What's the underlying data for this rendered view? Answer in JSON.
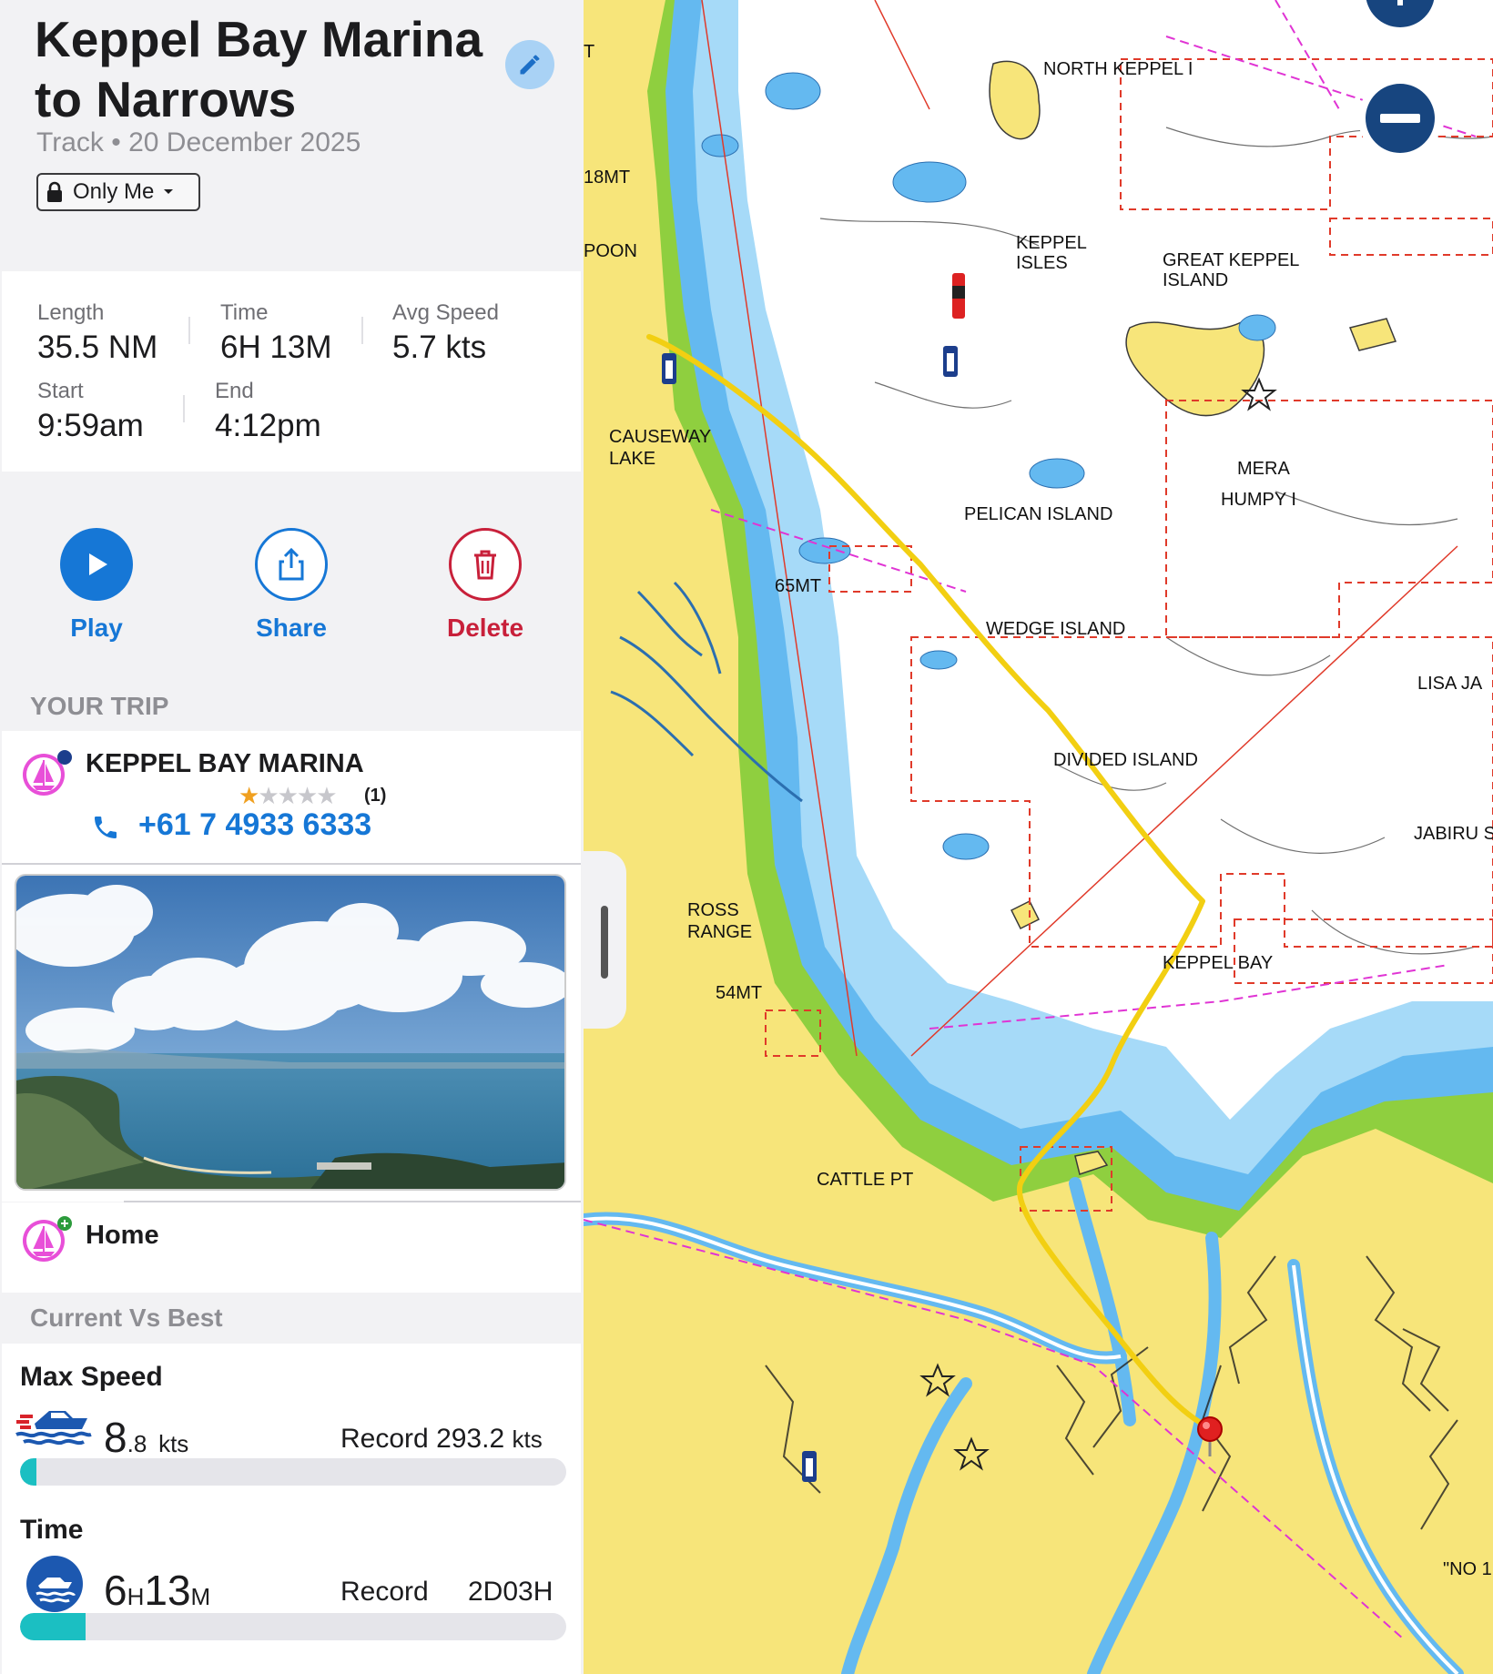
{
  "header": {
    "title": "Keppel Bay Marina to Narrows",
    "subtitle_type": "Track",
    "subtitle_sep": "•",
    "subtitle_date": "20 December 2025",
    "privacy": "Only Me"
  },
  "stats": {
    "length_label": "Length",
    "length_value": "35.5 NM",
    "time_label": "Time",
    "time_value": "6H 13M",
    "avg_label": "Avg Speed",
    "avg_value": "5.7 kts",
    "start_label": "Start",
    "start_value": "9:59am",
    "end_label": "End",
    "end_value": "4:12pm"
  },
  "actions": {
    "play": "Play",
    "share": "Share",
    "delete": "Delete"
  },
  "trip": {
    "section_title": "YOUR TRIP",
    "poi_name": "KEPPEL BAY MARINA",
    "rating": 1,
    "rating_count": "(1)",
    "phone": "+61 7 4933 6333",
    "home_label": "Home"
  },
  "compare": {
    "section_title": "Current Vs Best",
    "max_speed_label": "Max Speed",
    "max_speed_int": "8",
    "max_speed_dec": ".8",
    "max_speed_unit": "kts",
    "record_label": "Record",
    "max_speed_record": "293.2",
    "max_speed_record_unit": "kts",
    "max_speed_fraction": 0.03,
    "time_label": "Time",
    "time_h": "6",
    "time_h_unit": "H",
    "time_m": "13",
    "time_m_unit": "M",
    "time_record": "2D03H",
    "time_fraction": 0.12
  },
  "map": {
    "labels": {
      "north_keppel": "NORTH KEPPEL I",
      "keppel_isles": "KEPPEL\nISLES",
      "great_keppel": "GREAT KEPPEL\nISLAND",
      "causeway": "CAUSEWAY\nLAKE",
      "pelican": "PELICAN ISLAND",
      "mera": "MERA",
      "humpy": "HUMPY I",
      "wedge": "WEDGE ISLAND",
      "divided": "DIVIDED ISLAND",
      "lisa": "LISA JA",
      "jabiru": "JABIRU S",
      "ross": "ROSS\nRANGE",
      "keppel_bay": "KEPPEL BAY",
      "cattle": "CATTLE PT",
      "m18": "18MT",
      "poon": "POON",
      "m65": "65MT",
      "m54": "54MT",
      "no": "\"NO 1",
      "t": "T"
    },
    "colors": {
      "land": "#f7e57a",
      "shallow": "#64b9f0",
      "mid": "#a6daf8",
      "deep": "#ffffff",
      "green": "#8fcf3f",
      "track": "#f2cf12"
    }
  }
}
